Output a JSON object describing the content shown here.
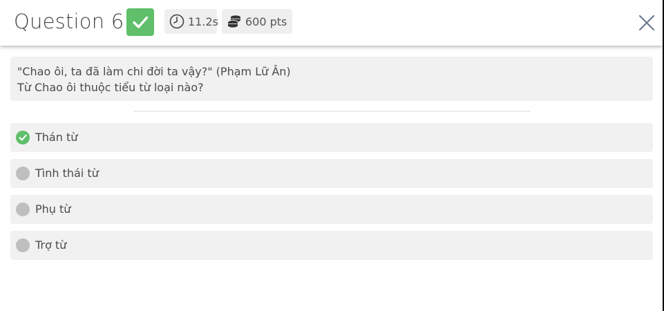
{
  "header": {
    "title": "Question 6",
    "status_icon": "check-icon",
    "status_color": "#5fbf6a",
    "time": "11.2s",
    "time_icon": "clock-icon",
    "points": "600 pts",
    "points_icon": "coins-icon",
    "close_icon": "close-icon"
  },
  "question": {
    "line1": "\"Chao ôi, ta đã làm chi đời ta vậy?\" (Phạm Lữ Ân)",
    "line2": "Từ Chao ôi thuộc tiểu từ loại nào?"
  },
  "options": [
    {
      "label": "Thán từ",
      "state": "correct"
    },
    {
      "label": "Tình thái từ",
      "state": "unselected"
    },
    {
      "label": "Phụ từ",
      "state": "unselected"
    },
    {
      "label": "Trợ từ",
      "state": "unselected"
    }
  ]
}
